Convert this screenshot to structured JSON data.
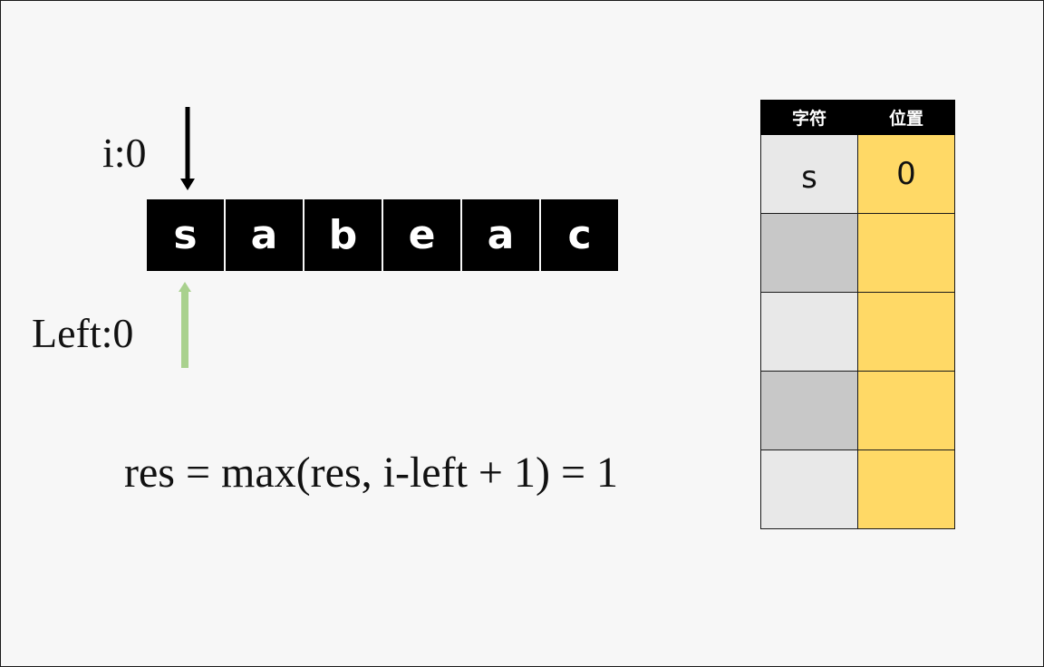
{
  "pointers": {
    "i_label": "i:0",
    "left_label": "Left:0"
  },
  "string_chars": [
    "s",
    "a",
    "b",
    "e",
    "a",
    "c"
  ],
  "formula": "res = max(res, i-left + 1) = 1",
  "table": {
    "headers": [
      "字符",
      "位置"
    ],
    "rows": [
      {
        "char": "s",
        "pos": "0"
      },
      {
        "char": "",
        "pos": ""
      },
      {
        "char": "",
        "pos": ""
      },
      {
        "char": "",
        "pos": ""
      },
      {
        "char": "",
        "pos": ""
      }
    ]
  },
  "colors": {
    "i_arrow": "#000000",
    "left_arrow": "#a9d18e",
    "char_cell_bg": "#000000",
    "position_col_bg": "#ffd966",
    "char_col_light": "#e8e8e8",
    "char_col_dark": "#c8c8c8"
  }
}
